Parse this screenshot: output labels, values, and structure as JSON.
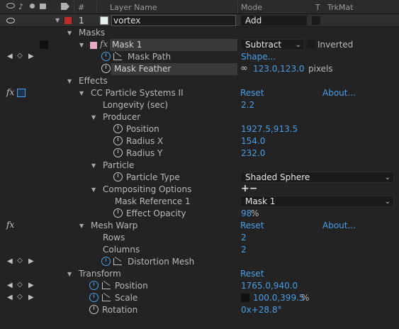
{
  "header": {
    "hash": "#",
    "layer_name": "Layer Name",
    "mode": "Mode",
    "t": "T",
    "trkmat": "TrkMat"
  },
  "layer": {
    "number": "1",
    "name": "vortex",
    "mode": "Add"
  },
  "masks": {
    "label": "Masks",
    "mask1": {
      "name": "Mask 1",
      "mode": "Subtract",
      "inverted_label": "Inverted",
      "mask_path_label": "Mask Path",
      "mask_path_value": "Shape...",
      "mask_feather_label": "Mask Feather",
      "mask_feather_value": "123.0,123.0",
      "mask_feather_unit": " pixels"
    }
  },
  "effects": {
    "label": "Effects",
    "cc": {
      "name": "CC Particle Systems II",
      "reset": "Reset",
      "about": "About...",
      "longevity_label": "Longevity (sec)",
      "longevity_value": "2.2",
      "producer_label": "Producer",
      "position_label": "Position",
      "position_value": "1927.5,913.5",
      "radius_x_label": "Radius X",
      "radius_x_value": "154.0",
      "radius_y_label": "Radius Y",
      "radius_y_value": "232.0",
      "particle_label": "Particle",
      "particle_type_label": "Particle Type",
      "particle_type_value": "Shaded Sphere",
      "compositing_label": "Compositing Options",
      "plus_minus": "+−",
      "mask_ref_label": "Mask Reference 1",
      "mask_ref_value": "Mask 1",
      "effect_opacity_label": "Effect Opacity",
      "effect_opacity_value": "98",
      "effect_opacity_unit": "%"
    },
    "meshwarp": {
      "name": "Mesh Warp",
      "reset": "Reset",
      "about": "About...",
      "rows_label": "Rows",
      "rows_value": "2",
      "columns_label": "Columns",
      "columns_value": "2",
      "distortion_label": "Distortion Mesh"
    }
  },
  "transform": {
    "label": "Transform",
    "reset": "Reset",
    "position_label": "Position",
    "position_value": "1765.0,940.0",
    "scale_label": "Scale",
    "scale_value": "100.0,399.5",
    "scale_unit": "%",
    "rotation_label": "Rotation",
    "rotation_value": "0x+28.8°"
  },
  "glyphs": {
    "fx": "fx",
    "tri_down": "▼",
    "kf_left": "◀",
    "kf_diamond": "◇",
    "kf_right": "▶",
    "chev": "⌄",
    "link": "∞"
  },
  "colors": {
    "accent_blue": "#4a9ee8",
    "layer_label": "#c02a2a",
    "mask_swatch": "#e8a8c8"
  }
}
